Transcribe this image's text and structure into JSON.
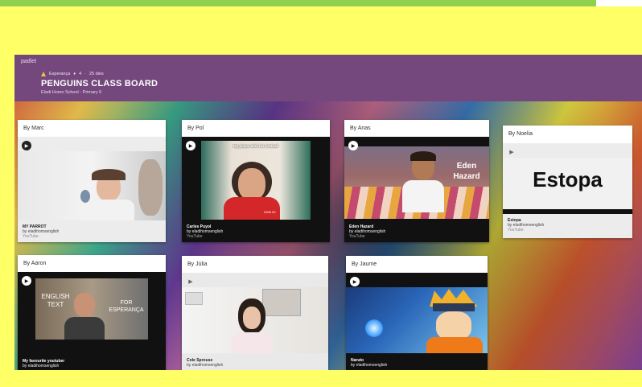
{
  "app": {
    "logo": "padlet"
  },
  "board": {
    "author": "Esperança",
    "likes": "4",
    "age": "25 dies",
    "title": "PENGUINS CLASS BOARD",
    "subtitle": "Eladi Home School - Primary 6"
  },
  "cards": [
    {
      "by": "By Marc",
      "title": "MY PARROT",
      "author": "by eladihomsenglish",
      "source": "YouTube"
    },
    {
      "by": "By Pol",
      "title": "Carles Puyol",
      "author": "by eladihomsenglish",
      "source": "YouTube",
      "overlay": "My player with his football",
      "overlay2": "2008 03"
    },
    {
      "by": "By Anas",
      "title": "Eden Hazard",
      "author": "by eladihomsenglish",
      "source": "YouTube",
      "overlay": "Eden Hazard"
    },
    {
      "by": "By Noelia",
      "title": "Estopa",
      "author": "by eladihomsenglish",
      "source": "YouTube",
      "overlay": "Estopa"
    },
    {
      "by": "By Aaron",
      "title": "My favourite youtuber",
      "author": "by eladihomsenglish",
      "source": "",
      "overlay": "ENGLISH TEXT",
      "overlay2": "FOR ESPERANÇA"
    },
    {
      "by": "By Júlia",
      "title": "Cole Sprouse",
      "author": "by eladihomsenglish",
      "source": ""
    },
    {
      "by": "By Jaume",
      "title": "Naruto",
      "author": "by eladihomsenglish",
      "source": ""
    }
  ],
  "colors": {
    "header": "#74487d",
    "page": "#ffff66",
    "accent": "#8fd14f"
  }
}
